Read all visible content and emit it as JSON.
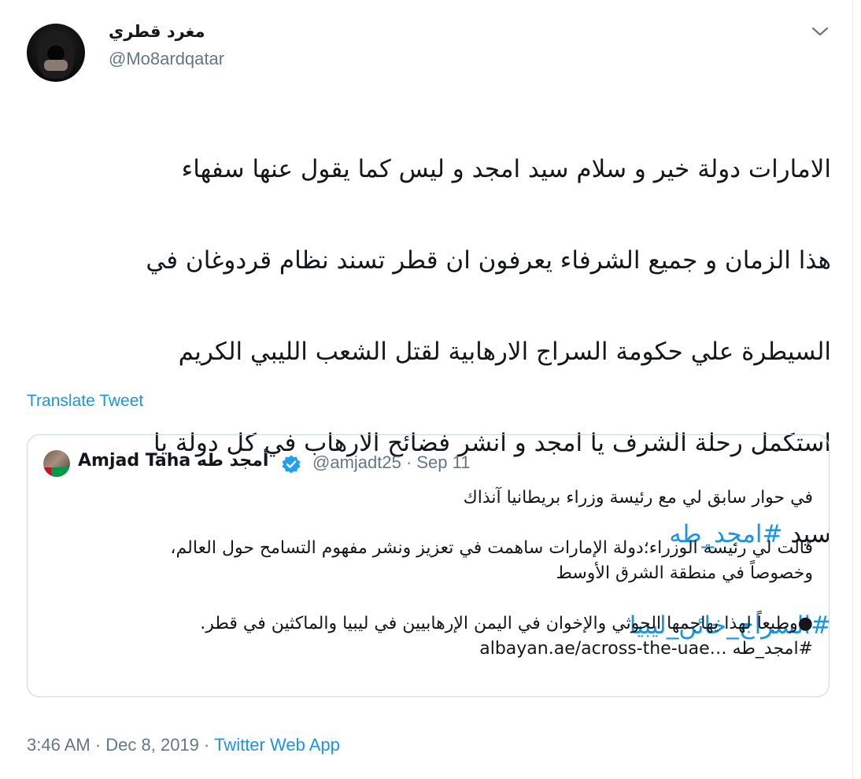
{
  "author": {
    "display_name": "مغرد قطري",
    "handle": "@Mo8ardqatar"
  },
  "tweet": {
    "lines": [
      "الامارات دولة خير و سلام سيد امجد و ليس كما يقول عنها سفهاء",
      "هذا الزمان و جميع الشرفاء يعرفون ان قطر تسند نظام قردوغان  في",
      "السيطرة علي حكومة السراج الارهابية لقتل الشعب الليبي الكريم",
      "استكمل رحلة الشرف يا امجد و انشر فضائح الارهاب في كل دولة يا"
    ],
    "last_line_text": "سيد ",
    "hashtag_1": "#امجد_طه",
    "hashtag_2": "#السراج_خائن_ليبيا"
  },
  "translate_label": "Translate Tweet",
  "quoted": {
    "display_name": "Amjad Taha أمجد طه",
    "handle_date": "@amjadt25 · Sep 11",
    "para_1": "في حوار سابق لي مع رئيسة وزراء بريطانيا  آنذاك",
    "para_2_line_1": " قالت لي رئيسة الوزراء؛دولة الإمارات ساهمت في تعزيز ونشر مفهوم التسامح حول العالم،",
    "para_2_line_2": "وخصوصاً في منطقة الشرق الأوسط",
    "para_3_line_1": "●وطبعاً لهذا يهاجمها الحوثي والإخوان في اليمن الإرهابيين في ليبيا والماكثين في قطر.",
    "para_3_line_2": "#امجد_طه  …albayan.ae/across-the-uae"
  },
  "meta": {
    "time": "3:46 AM",
    "sep_1": " · ",
    "date": "Dec 8, 2019",
    "sep_2": " · ",
    "source": "Twitter Web App"
  },
  "colors": {
    "link": "#1b95e0",
    "secondary_text": "#657786",
    "border": "#ccd6dd",
    "verified": "#1da1f2"
  },
  "icons": {
    "caret": "chevron-down-icon",
    "verified": "verified-badge-icon"
  }
}
